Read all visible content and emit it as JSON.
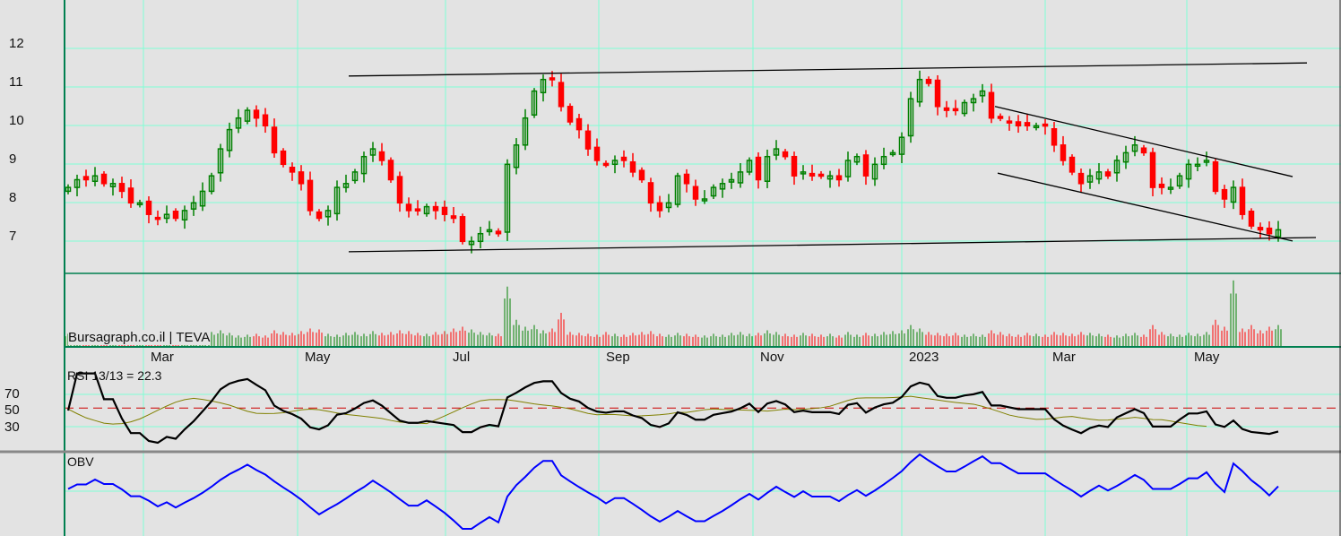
{
  "chart_data": {
    "type": "candlestick",
    "title": "Bursagraph.co.il | TEVA",
    "x_unit": "bar index (approx. 2 trading days per bar)",
    "price_ticks": [
      "7",
      "8",
      "9",
      "10",
      "11",
      "12"
    ],
    "ylim": [
      5.8,
      12.9
    ],
    "month_labels": [
      {
        "label": "Mar",
        "index": 8.4
      },
      {
        "label": "May",
        "index": 25.6
      },
      {
        "label": "Jul",
        "index": 42.1
      },
      {
        "label": "Sep",
        "index": 59.2
      },
      {
        "label": "Nov",
        "index": 76.4
      },
      {
        "label": "2023",
        "index": 93
      },
      {
        "label": "Mar",
        "index": 109
      },
      {
        "label": "May",
        "index": 124.8
      }
    ],
    "close": [
      8.3,
      8.5,
      8.5,
      8.6,
      8.4,
      8.4,
      8.2,
      7.9,
      7.9,
      7.6,
      7.5,
      7.6,
      7.5,
      7.7,
      7.9,
      8.2,
      8.6,
      9.3,
      9.8,
      10.1,
      10.3,
      10.1,
      9.9,
      9.2,
      8.9,
      8.7,
      8.4,
      7.7,
      7.5,
      7.7,
      8.3,
      8.4,
      8.7,
      9.1,
      9.3,
      9.0,
      8.5,
      7.9,
      7.7,
      7.7,
      7.8,
      7.7,
      7.6,
      7.5,
      6.9,
      6.9,
      7.1,
      7.2,
      7.1,
      8.9,
      9.4,
      10.1,
      10.8,
      11.1,
      11.1,
      10.4,
      10.0,
      9.8,
      9.3,
      9.0,
      8.9,
      9.0,
      9.0,
      8.7,
      8.5,
      7.9,
      7.7,
      7.9,
      8.6,
      8.4,
      8.0,
      8.0,
      8.3,
      8.4,
      8.5,
      8.7,
      9.0,
      8.5,
      9.1,
      9.3,
      9.1,
      8.6,
      8.7,
      8.6,
      8.6,
      8.6,
      8.5,
      9.0,
      9.1,
      8.6,
      8.9,
      9.1,
      9.2,
      9.6,
      10.6,
      11.1,
      11.0,
      10.4,
      10.3,
      10.3,
      10.5,
      10.6,
      10.8,
      10.1,
      10.1,
      10.0,
      9.9,
      9.9,
      9.9,
      9.9,
      9.4,
      9.0,
      8.7,
      8.4,
      8.6,
      8.7,
      8.6,
      9.0,
      9.2,
      9.4,
      9.2,
      8.3,
      8.3,
      8.3,
      8.6,
      8.9,
      8.9,
      9.0,
      8.2,
      8.0,
      8.3,
      7.6,
      7.3,
      7.2,
      7.1,
      7.2
    ],
    "volume": [
      14,
      12,
      16,
      13,
      12,
      15,
      14,
      18,
      13,
      12,
      15,
      11,
      14,
      13,
      12,
      14,
      16,
      18,
      15,
      12,
      13,
      14,
      12,
      18,
      16,
      15,
      17,
      20,
      19,
      14,
      13,
      15,
      16,
      14,
      17,
      15,
      16,
      18,
      17,
      15,
      14,
      16,
      17,
      20,
      22,
      19,
      16,
      15,
      14,
      68,
      30,
      22,
      24,
      18,
      20,
      38,
      16,
      15,
      14,
      13,
      16,
      14,
      13,
      15,
      16,
      17,
      14,
      13,
      15,
      14,
      13,
      12,
      14,
      13,
      15,
      16,
      14,
      15,
      18,
      16,
      14,
      13,
      15,
      14,
      13,
      14,
      12,
      16,
      13,
      15,
      14,
      16,
      17,
      18,
      24,
      20,
      16,
      15,
      14,
      15,
      13,
      14,
      13,
      18,
      16,
      14,
      13,
      15,
      14,
      13,
      16,
      15,
      14,
      16,
      15,
      14,
      13,
      12,
      14,
      15,
      13,
      24,
      16,
      14,
      13,
      15,
      14,
      16,
      30,
      22,
      75,
      20,
      24,
      18,
      22,
      24
    ],
    "trendlines": [
      {
        "from": [
          31.3,
          11.19
        ],
        "to": [
          138.2,
          11.53
        ]
      },
      {
        "from": [
          31.3,
          6.63
        ],
        "to": [
          139.2,
          7.0
        ]
      },
      {
        "from": [
          103.4,
          10.4
        ],
        "to": [
          136.6,
          8.58
        ]
      },
      {
        "from": [
          103.7,
          8.67
        ],
        "to": [
          136.6,
          6.91
        ]
      }
    ],
    "rsi": {
      "label": "RSI 13/13 = 22.3",
      "period": 13,
      "signal_period": 13,
      "ticks": [
        "30",
        "50",
        "70"
      ],
      "ylim": [
        0,
        100
      ]
    },
    "obv": {
      "label": "OBV"
    },
    "colors": {
      "up": "#008000",
      "down": "#ff0000",
      "grid": "#7fffd4",
      "rsi": "#000000",
      "signal": "#808000",
      "obv": "#0000ff",
      "axis": "#008050"
    }
  }
}
